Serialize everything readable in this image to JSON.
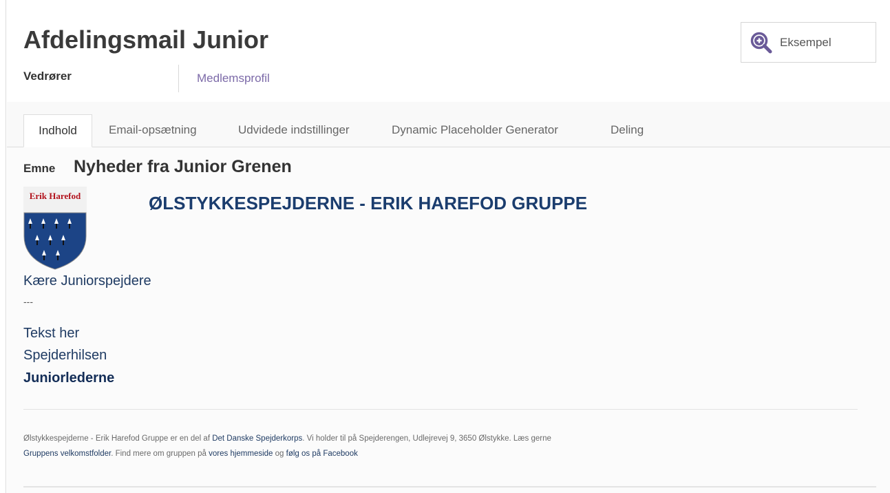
{
  "page": {
    "title": "Afdelingsmail Junior",
    "preview_button": "Eksempel",
    "concerns_label": "Vedrører",
    "concerns_value": "Medlemsprofil"
  },
  "tabs": [
    "Indhold",
    "Email-opsætning",
    "Udvidede indstillinger",
    "Dynamic Placeholder Generator",
    "Deling"
  ],
  "active_tab": "Indhold",
  "content": {
    "subject_label": "Emne",
    "subject_value": "Nyheder fra Junior Grenen",
    "logo_text": "Erik Harefod",
    "org_title": "ØLSTYKKESPEJDERNE - ERIK HAREFOD GRUPPE",
    "greeting": "Kære Juniorspejdere",
    "separator": "---",
    "body": "Tekst her",
    "signoff": "Spejderhilsen",
    "signature": "Juniorlederne"
  },
  "footer": {
    "t1": "Ølstykkespejderne - Erik Harefod Gruppe er en del af ",
    "link1": "Det Danske Spejderkorps",
    "t2": ". Vi holder til på Spejderengen, Udlejrevej 9, 3650 Ølstykke. Læs gerne ",
    "link2": "Gruppens velkomstfolder",
    "t3": ". Find mere om gruppen på ",
    "link3": "vores hjemmeside",
    "t4": " og ",
    "link4": "følg os på Facebook"
  },
  "icons": {
    "preview": "zoom-in-icon",
    "logo": "shield-logo"
  },
  "colors": {
    "accent": "#7c6aa8",
    "brand_blue": "#1b3d6e",
    "logo_red": "#b2121c",
    "shield_blue": "#1c4486"
  }
}
